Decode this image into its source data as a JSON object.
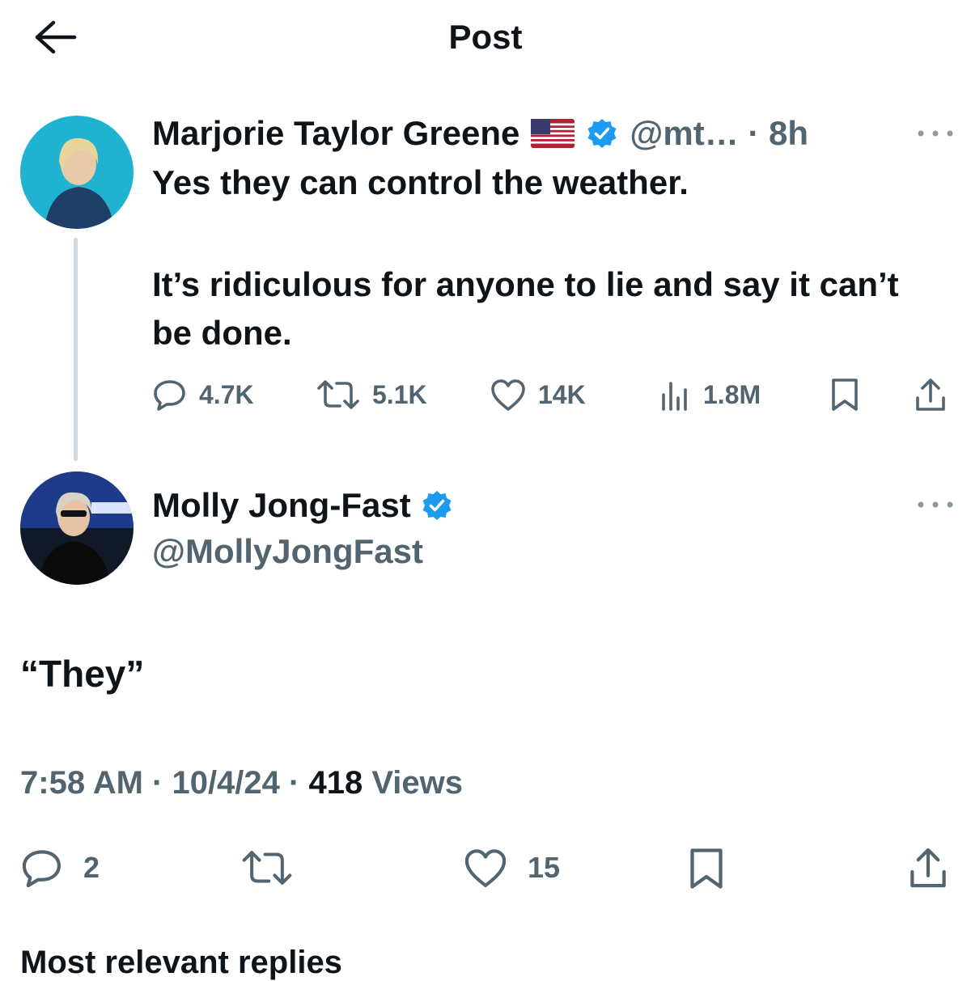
{
  "header": {
    "title": "Post"
  },
  "parent_post": {
    "author_name": "Marjorie Taylor Greene",
    "handle": "@mt…",
    "separator": " · ",
    "time": "8h",
    "text_line1": "Yes they can control the weather.",
    "text_para2": "It’s ridiculous for anyone to lie and say it can’t be done.",
    "stats": {
      "replies": "4.7K",
      "reposts": "5.1K",
      "likes": "14K",
      "views": "1.8M"
    }
  },
  "reply_post": {
    "author_name": "Molly Jong-Fast",
    "handle": "@MollyJongFast",
    "text": "“They”",
    "time": "7:58 AM",
    "date": "10/4/24",
    "sep": " · ",
    "views_count": "418",
    "views_label": " Views",
    "stats": {
      "replies": "2",
      "likes": "15"
    }
  },
  "below_fold": {
    "text": "Most relevant replies"
  },
  "colors": {
    "verified": "#1d9bf0",
    "secondary_text": "#536471",
    "thread_line": "#cfd9de"
  }
}
